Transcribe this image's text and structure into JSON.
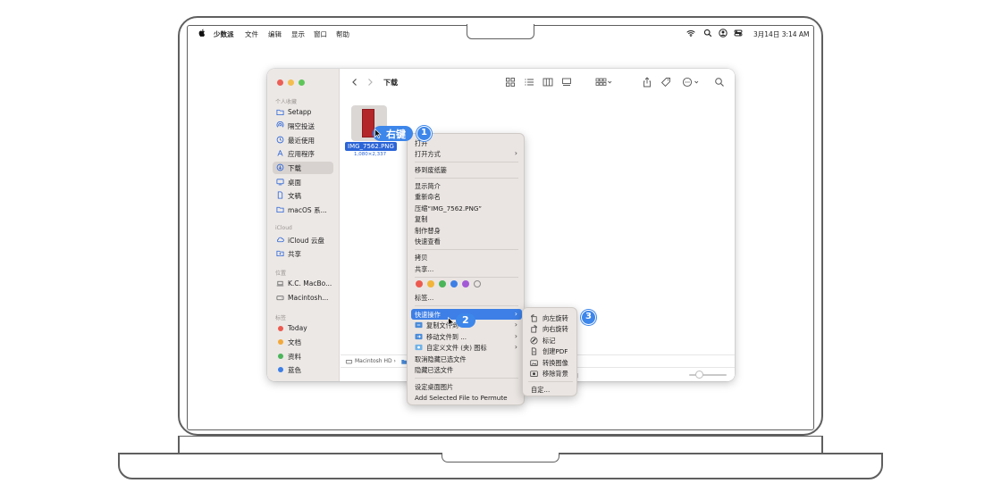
{
  "menubar": {
    "items": [
      "少数派",
      "文件",
      "编辑",
      "显示",
      "窗口",
      "帮助"
    ],
    "date_time": "3月14日  3:14 AM"
  },
  "finder": {
    "title": "下载",
    "sidebar": {
      "sections": {
        "favorites": "个人收藏",
        "icloud": "iCloud",
        "locations": "位置",
        "tags": "标签"
      },
      "favorites": [
        "Setapp",
        "隔空投送",
        "最近使用",
        "应用程序",
        "下载",
        "桌面",
        "文稿",
        "macOS 系..."
      ],
      "icloud": [
        "iCloud 云盘",
        "共享"
      ],
      "locations": [
        "K.C. MacBo...",
        "Macintosh..."
      ],
      "tags": [
        {
          "label": "Today",
          "color": "#ec5a4f"
        },
        {
          "label": "文档",
          "color": "#f2a93b"
        },
        {
          "label": "资料",
          "color": "#4bb55a"
        },
        {
          "label": "蓝色",
          "color": "#3d7fe6"
        }
      ]
    },
    "file": {
      "name": "IMG_7562.PNG",
      "size": "1,080×2,337"
    },
    "pathbar": "Macintosh HD  ›",
    "status_fragment": "用"
  },
  "context_menu": {
    "open": "打开",
    "open_with": "打开方式",
    "trash": "移到废纸篓",
    "get_info": "显示简介",
    "rename": "重新命名",
    "compress": "压缩“IMG_7562.PNG”",
    "duplicate": "复制",
    "make_alias": "制作替身",
    "quick_look": "快速查看",
    "copy": "拷贝",
    "share": "共享...",
    "tag_colors": [
      "#ec5a4f",
      "#f2b53b",
      "#4bb55a",
      "#3d7fe6",
      "#a35ad6"
    ],
    "tags": "标签...",
    "quick_actions": "快速操作",
    "copy_file_to": "复制文件到",
    "move_file_to": "移动文件到 ...",
    "custom_icon": "自定义文件 (夹) 图标",
    "unhide_hidden": "取消隐藏已选文件",
    "hide_selected": "隐藏已选文件",
    "set_wallpaper": "设定桌面图片",
    "permute": "Add Selected File to Permute"
  },
  "submenu": {
    "items": [
      "向左旋转",
      "向右旋转",
      "标记",
      "创建PDF",
      "转换图像",
      "移除背景"
    ],
    "customize": "自定..."
  },
  "annotations": {
    "right_click_label": "右键",
    "step1": "1",
    "step2": "2",
    "step3": "3"
  }
}
